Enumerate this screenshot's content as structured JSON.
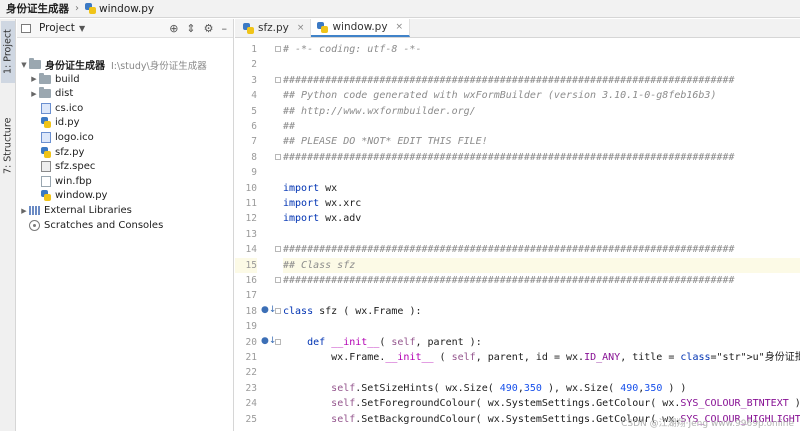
{
  "breadcrumb": {
    "project": "身份证生成器",
    "file": "window.py"
  },
  "toolstrip": {
    "project_tab": "1: Project",
    "structure_tab": "7: Structure"
  },
  "project_panel": {
    "title": "Project",
    "root": {
      "name": "身份证生成器",
      "path": "I:\\study\\身份证生成器"
    },
    "items": [
      {
        "name": "build",
        "kind": "folder"
      },
      {
        "name": "dist",
        "kind": "folder"
      },
      {
        "name": "cs.ico",
        "kind": "ico"
      },
      {
        "name": "id.py",
        "kind": "py"
      },
      {
        "name": "logo.ico",
        "kind": "ico"
      },
      {
        "name": "sfz.py",
        "kind": "py"
      },
      {
        "name": "sfz.spec",
        "kind": "spec"
      },
      {
        "name": "win.fbp",
        "kind": "file"
      },
      {
        "name": "window.py",
        "kind": "py"
      }
    ],
    "external_libraries": "External Libraries",
    "scratches": "Scratches and Consoles"
  },
  "tabs": [
    {
      "label": "sfz.py",
      "active": false
    },
    {
      "label": "window.py",
      "active": true
    }
  ],
  "code_lines": [
    {
      "n": "1",
      "text": "# -*- coding: utf-8 -*-"
    },
    {
      "n": "2",
      "text": ""
    },
    {
      "n": "3",
      "text": "###########################################################################"
    },
    {
      "n": "4",
      "text": "## Python code generated with wxFormBuilder (version 3.10.1-0-g8feb16b3)"
    },
    {
      "n": "5",
      "text": "## http://www.wxformbuilder.org/"
    },
    {
      "n": "6",
      "text": "##"
    },
    {
      "n": "7",
      "text": "## PLEASE DO *NOT* EDIT THIS FILE!"
    },
    {
      "n": "8",
      "text": "###########################################################################"
    },
    {
      "n": "9",
      "text": ""
    },
    {
      "n": "10",
      "text": "import wx"
    },
    {
      "n": "11",
      "text": "import wx.xrc"
    },
    {
      "n": "12",
      "text": "import wx.adv"
    },
    {
      "n": "13",
      "text": ""
    },
    {
      "n": "14",
      "text": "###########################################################################"
    },
    {
      "n": "15",
      "text": "## Class sfz"
    },
    {
      "n": "16",
      "text": "###########################################################################"
    },
    {
      "n": "17",
      "text": ""
    },
    {
      "n": "18",
      "text": "class sfz ( wx.Frame ):"
    },
    {
      "n": "19",
      "text": ""
    },
    {
      "n": "20",
      "text": "    def __init__( self, parent ):"
    },
    {
      "n": "21",
      "text": "        wx.Frame.__init__ ( self, parent, id = wx.ID_ANY, title = u\"身份证批量生成器"
    },
    {
      "n": "22",
      "text": ""
    },
    {
      "n": "23",
      "text": "        self.SetSizeHints( wx.Size( 490,350 ), wx.Size( 490,350 ) )"
    },
    {
      "n": "24",
      "text": "        self.SetForegroundColour( wx.SystemSettings.GetColour( wx.SYS_COLOUR_BTNTEXT ) )"
    },
    {
      "n": "25",
      "text": "        self.SetBackgroundColour( wx.SystemSettings.GetColour( wx.SYS_COLOUR_HIGHLIGHTTEXT"
    }
  ],
  "watermark": "CSDN @江湖翔·Jeng  www.9969p.online",
  "colors": {
    "accent": "#4083c9",
    "highlight_line": "#fcfae6",
    "comment": "#8c8c8c",
    "keyword": "#0033b3"
  }
}
